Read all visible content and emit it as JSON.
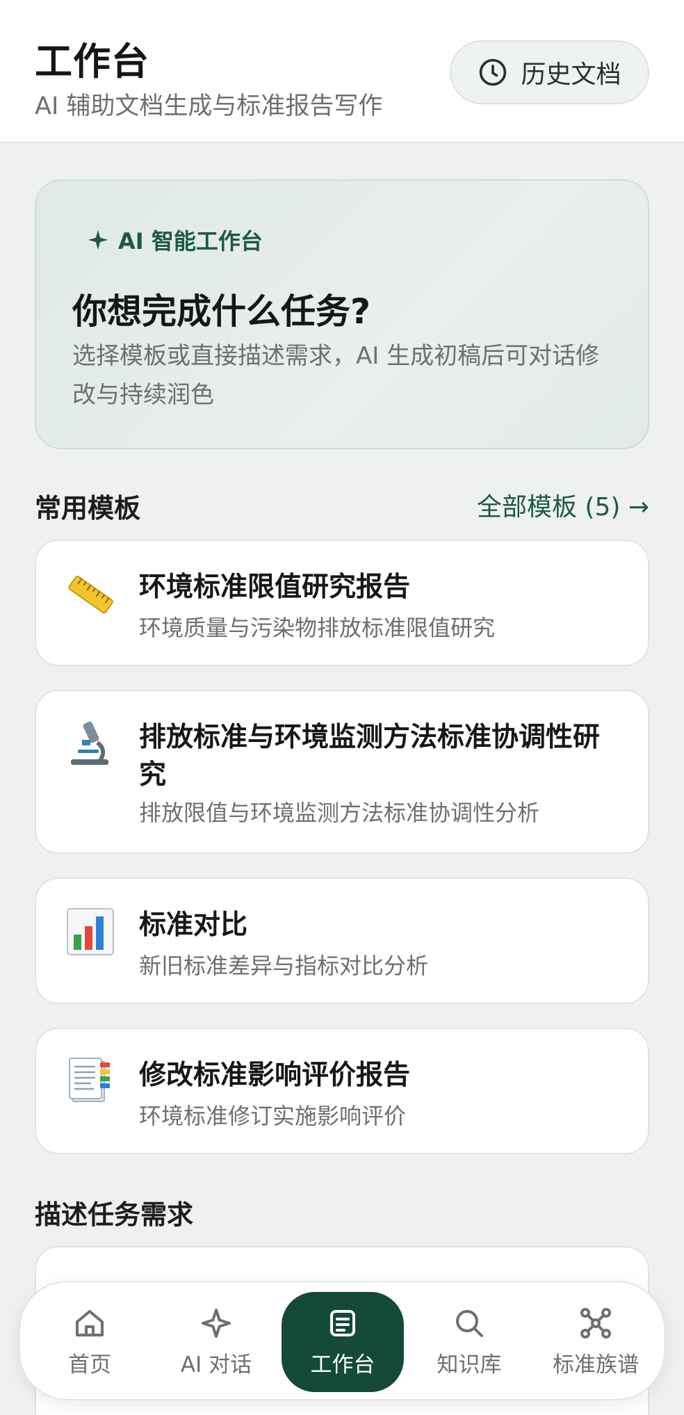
{
  "header": {
    "title": "工作台",
    "subtitle": "AI 辅助文档生成与标准报告写作",
    "history_label": "历史文档"
  },
  "hero": {
    "badge": "AI 智能工作台",
    "title": "你想完成什么任务?",
    "description": "选择模板或直接描述需求，AI 生成初稿后可对话修改与持续润色"
  },
  "templates_section": {
    "title": "常用模板",
    "all_link": "全部模板 (5) →"
  },
  "templates": [
    {
      "icon": "ruler-icon",
      "title": "环境标准限值研究报告",
      "desc": "环境质量与污染物排放标准限值研究"
    },
    {
      "icon": "microscope-icon",
      "title": "排放标准与环境监测方法标准协调性研究",
      "desc": "排放限值与环境监测方法标准协调性分析"
    },
    {
      "icon": "bar-chart-icon",
      "title": "标准对比",
      "desc": "新旧标准差异与指标对比分析"
    },
    {
      "icon": "document-icon",
      "title": "修改标准影响评价报告",
      "desc": "环境标准修订实施影响评价"
    }
  ],
  "describe_section": {
    "title": "描述任务需求"
  },
  "nav": {
    "active": "工作台",
    "items": [
      {
        "label": "首页",
        "icon": "home-icon"
      },
      {
        "label": "AI 对话",
        "icon": "sparkle-icon"
      },
      {
        "label": "工作台",
        "icon": "document-icon"
      },
      {
        "label": "知识库",
        "icon": "search-icon"
      },
      {
        "label": "标准族谱",
        "icon": "graph-icon"
      }
    ]
  },
  "colors": {
    "accent": "#144a36",
    "accent_text": "#1d5a42",
    "background": "#eef1ef"
  }
}
